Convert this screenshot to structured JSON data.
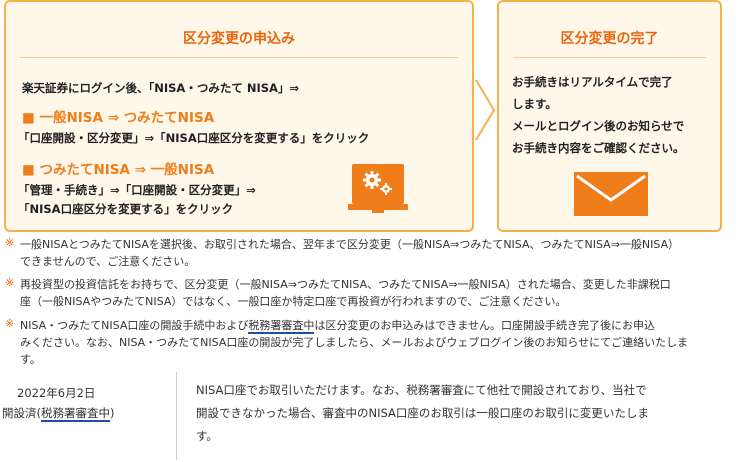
{
  "apply_card": {
    "title": "区分変更の申込み",
    "intro": "楽天証券にログイン後、「NISA・つみたて NISA」⇒",
    "route1_heading": "■ 一般NISA ⇒ つみたてNISA",
    "route1_steps": "「口座開設・区分変更」⇒「NISA口座区分を変更する」をクリック",
    "route2_heading": "■ つみたてNISA ⇒ 一般NISA",
    "route2_steps_line1": "「管理・手続き」⇒「口座開設・区分変更」⇒",
    "route2_steps_line2": "「NISA口座区分を変更する」をクリック"
  },
  "done_card": {
    "title": "区分変更の完了",
    "line1": "お手続きはリアルタイムで完了",
    "line2": "します。",
    "line3": "メールとログイン後のお知らせで",
    "line4": "お手続き内容をご確認ください。"
  },
  "notes": [
    {
      "mark": "※",
      "line1": "一般NISAとつみたてNISAを選択後、お取引された場合、翌年まで区分変更（一般NISA⇒つみたてNISA、つみたてNISA⇒一般NISA）",
      "line2": "できませんので、ご注意ください。"
    },
    {
      "mark": "※",
      "line1": "再投資型の投資信託をお持ちで、区分変更（一般NISA⇒つみたてNISA、つみたてNISA⇒一般NISA）された場合、変更した非課税口",
      "line2": "座（一般NISAやつみたてNISA）ではなく、一般口座か特定口座で再投資が行われますので、ご注意ください。"
    },
    {
      "mark": "※",
      "line1_pre": "NISA・つみたてNISA口座の開設手続中および",
      "line1_hl": "税務署審査中",
      "line1_post": "は区分変更のお申込みはできません。口座開設手続き完了後にお申込",
      "line2": "みください。なお、NISA・つみたてNISA口座の開設が完了しましたら、メールおよびウェブログイン後のお知らせにてご連絡いたしま",
      "line3": "す。"
    }
  ],
  "status_row": {
    "date": "2022年6月2日",
    "status_pre": "開設済(",
    "status_hl": "税務署審査中",
    "status_post": ")",
    "desc_line1": "NISA口座でお取引いただけます。なお、税務署審査にて他社で開設されており、当社で",
    "desc_line2": "開設できなかった場合、審査中のNISA口座のお取引は一般口座のお取引に変更いたしま",
    "desc_line3": "す。"
  },
  "colors": {
    "accent_orange": "#e8650c",
    "card_border": "#f6b24a",
    "card_bg": "#fff7ea",
    "highlight_underline": "#1e4fa8"
  },
  "icons": {
    "arrow": "chevron-right-icon",
    "settings": "gear-monitor-icon",
    "mail": "envelope-icon"
  }
}
